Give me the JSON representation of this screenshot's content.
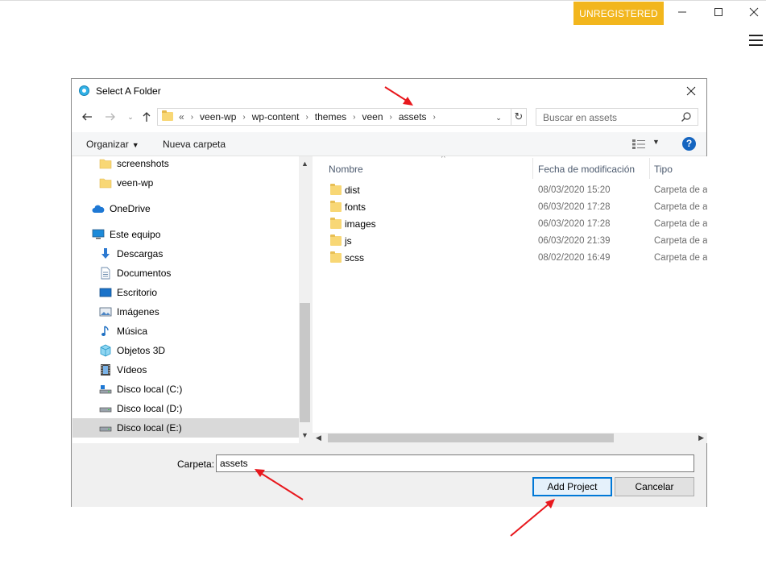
{
  "app": {
    "unregistered_label": "UNREGISTERED",
    "window_controls": [
      "minimize-icon",
      "maximize-icon",
      "close-icon"
    ],
    "menu_icon": "hamburger-menu-icon"
  },
  "dialog": {
    "title": "Select A Folder",
    "close_icon": "close-icon",
    "address": {
      "overflow": "«",
      "crumbs": [
        "veen-wp",
        "wp-content",
        "themes",
        "veen",
        "assets"
      ]
    },
    "search": {
      "placeholder": "Buscar en assets"
    },
    "toolbar": {
      "organize_label": "Organizar",
      "new_folder_label": "Nueva carpeta",
      "help_label": "?"
    },
    "tree": [
      {
        "label": "screenshots",
        "icon": "folder-icon"
      },
      {
        "label": "veen-wp",
        "icon": "folder-icon"
      },
      {
        "label": "OneDrive",
        "icon": "cloud-icon"
      },
      {
        "label": "Este equipo",
        "icon": "computer-icon"
      },
      {
        "label": "Descargas",
        "icon": "download-icon"
      },
      {
        "label": "Documentos",
        "icon": "document-icon"
      },
      {
        "label": "Escritorio",
        "icon": "desktop-icon"
      },
      {
        "label": "Imágenes",
        "icon": "image-icon"
      },
      {
        "label": "Música",
        "icon": "music-icon"
      },
      {
        "label": "Objetos 3D",
        "icon": "cube-icon"
      },
      {
        "label": "Vídeos",
        "icon": "video-icon"
      },
      {
        "label": "Disco local (C:)",
        "icon": "drive-icon"
      },
      {
        "label": "Disco local (D:)",
        "icon": "drive-icon"
      },
      {
        "label": "Disco local (E:)",
        "icon": "drive-icon",
        "selected": true
      }
    ],
    "columns": {
      "name": "Nombre",
      "modified": "Fecha de modificación",
      "type": "Tipo"
    },
    "files": [
      {
        "name": "dist",
        "modified": "08/03/2020 15:20",
        "type": "Carpeta de a"
      },
      {
        "name": "fonts",
        "modified": "06/03/2020 17:28",
        "type": "Carpeta de a"
      },
      {
        "name": "images",
        "modified": "06/03/2020 17:28",
        "type": "Carpeta de a"
      },
      {
        "name": "js",
        "modified": "06/03/2020 21:39",
        "type": "Carpeta de a"
      },
      {
        "name": "scss",
        "modified": "08/02/2020 16:49",
        "type": "Carpeta de a"
      }
    ],
    "folder_label": "Carpeta:",
    "folder_value": "assets",
    "add_button": "Add Project",
    "cancel_button": "Cancelar"
  },
  "colors": {
    "unregistered_bg": "#f2b61d",
    "annotation_arrow": "#e8181d",
    "primary_border": "#0078d7",
    "help_bg": "#1565c0"
  }
}
